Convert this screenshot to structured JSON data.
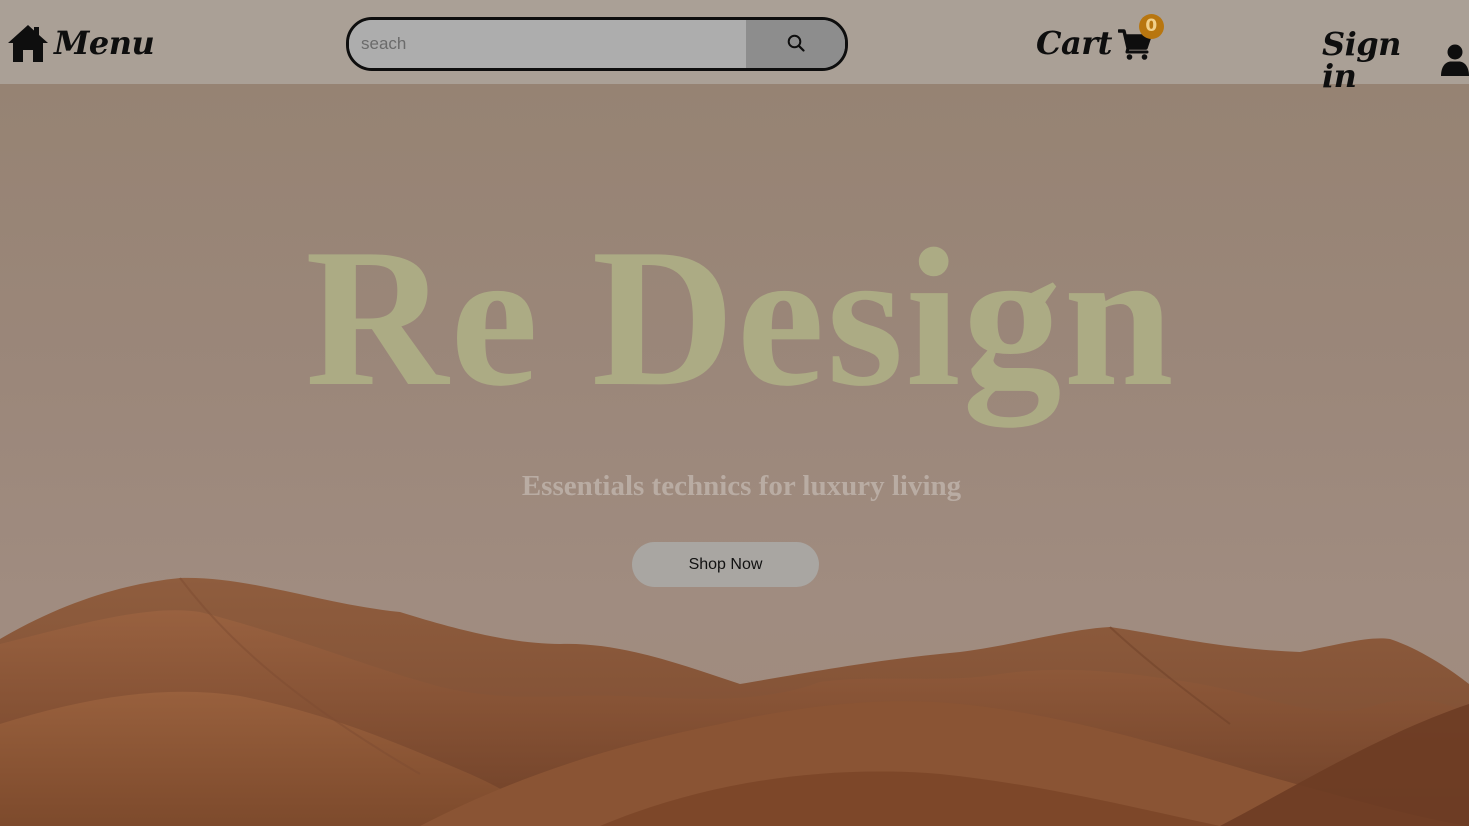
{
  "header": {
    "menu_label": "Menu",
    "search": {
      "placeholder": "seach",
      "value": ""
    },
    "cart": {
      "label": "Cart",
      "count": "0"
    },
    "signin_label": "Sign in"
  },
  "hero": {
    "title": "Re Design",
    "subtitle": "Essentials technics for luxury living",
    "cta_label": "Shop Now"
  },
  "icons": {
    "home": "home-icon",
    "search": "search-icon",
    "cart": "shopping-cart-icon",
    "user": "user-icon"
  },
  "colors": {
    "header_bg": "#aaa096",
    "hero_overlay": "#968373",
    "title": "#acab84",
    "subtitle": "#b9aca3",
    "badge": "#b8760f",
    "button_bg": "#a9a6a2",
    "search_button_bg": "#8d8d8d"
  }
}
